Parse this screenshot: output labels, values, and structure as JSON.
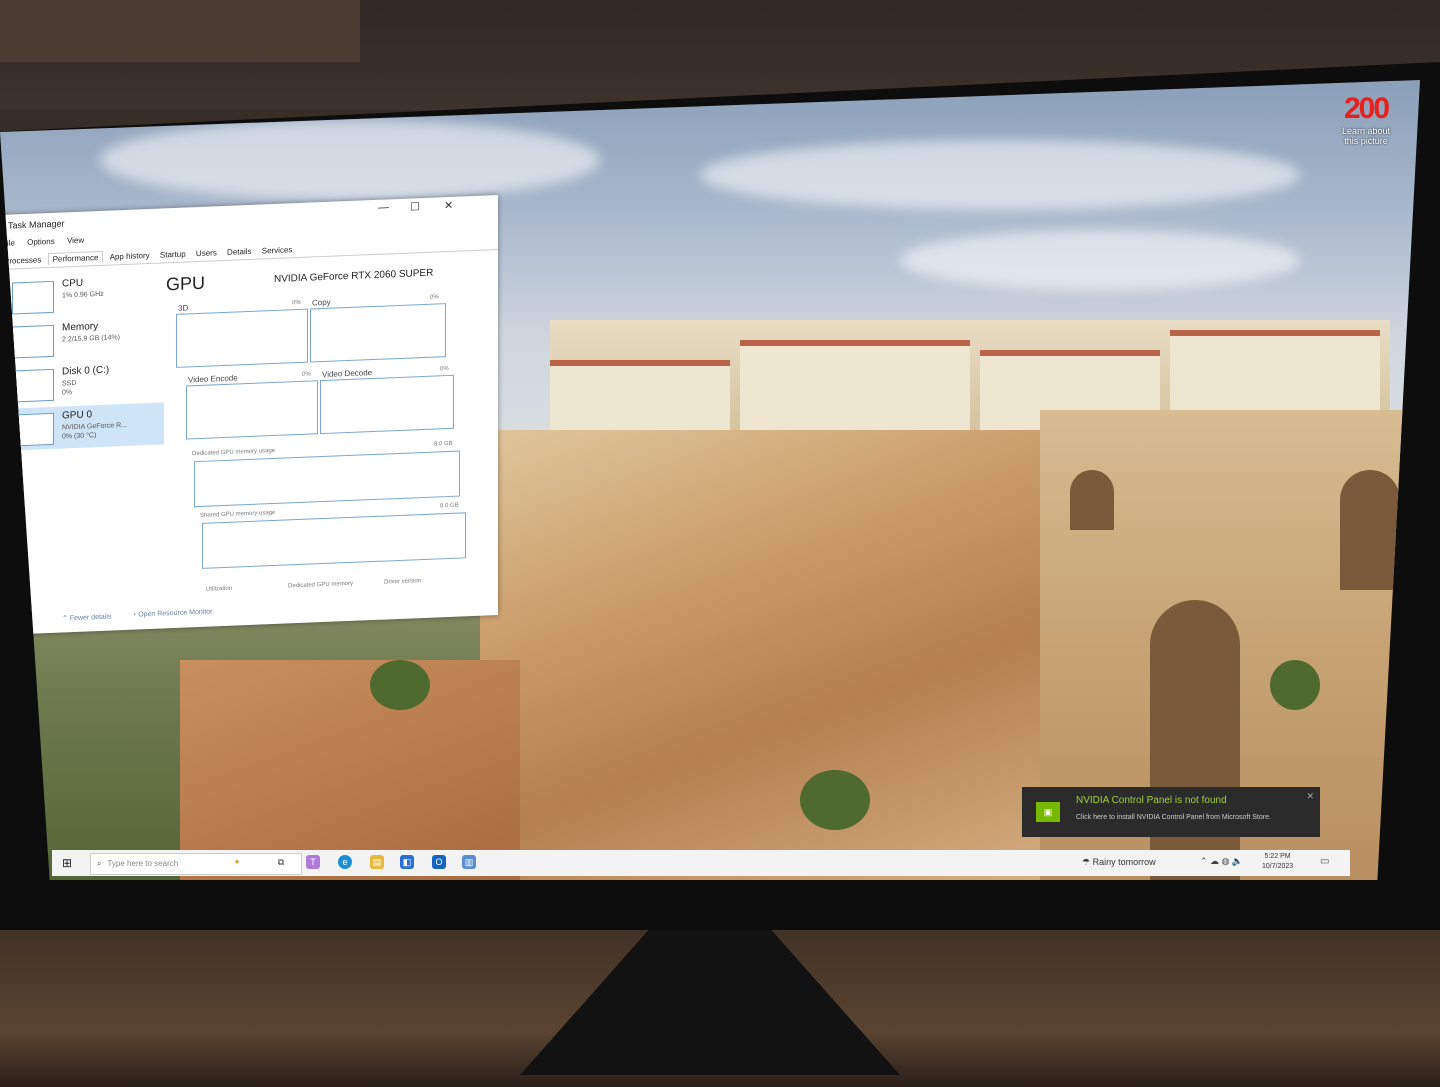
{
  "desktop": {
    "corner_logo": "200",
    "corner_caption": "Learn about this picture"
  },
  "task_manager": {
    "title": "Task Manager",
    "controls": {
      "minimize": "—",
      "maximize": "☐",
      "close": "✕"
    },
    "menu": [
      "File",
      "Options",
      "View"
    ],
    "tabs": [
      "Processes",
      "Performance",
      "App history",
      "Startup",
      "Users",
      "Details",
      "Services"
    ],
    "active_tab": "Performance",
    "sidebar": [
      {
        "name": "CPU",
        "sub": "1% 0.96 GHz"
      },
      {
        "name": "Memory",
        "sub": "2.2/15.9 GB (14%)"
      },
      {
        "name": "Disk 0 (C:)",
        "sub": "SSD",
        "sub2": "0%"
      },
      {
        "name": "GPU 0",
        "sub": "NVIDIA GeForce R...",
        "sub2": "0% (30 °C)"
      }
    ],
    "detail": {
      "heading": "GPU",
      "model": "NVIDIA GeForce RTX 2060 SUPER",
      "graphs": [
        {
          "label": "3D",
          "pct": "0%"
        },
        {
          "label": "Copy",
          "pct": "0%"
        },
        {
          "label": "Video Encode",
          "pct": "0%"
        },
        {
          "label": "Video Decode",
          "pct": "0%"
        }
      ],
      "dedicated_label": "Dedicated GPU memory usage",
      "dedicated_max": "8.0 GB",
      "shared_label": "Shared GPU memory usage",
      "shared_max": "8.0 GB",
      "footer_stats": [
        "Utilization",
        "Dedicated GPU memory",
        "Driver version"
      ]
    },
    "footer": {
      "fewer_details": "Fewer details",
      "open_resmon": "Open Resource Monitor"
    }
  },
  "taskbar": {
    "start_icon": "windows-icon",
    "search_placeholder": "Type here to search",
    "weather": "Rainy tomorrow",
    "time": "5:22 PM",
    "date": "10/7/2023"
  },
  "notification": {
    "title": "NVIDIA Control Panel is not found",
    "body": "Click here to install NVIDIA Control Panel from Microsoft Store.",
    "accent": "#76b900"
  }
}
